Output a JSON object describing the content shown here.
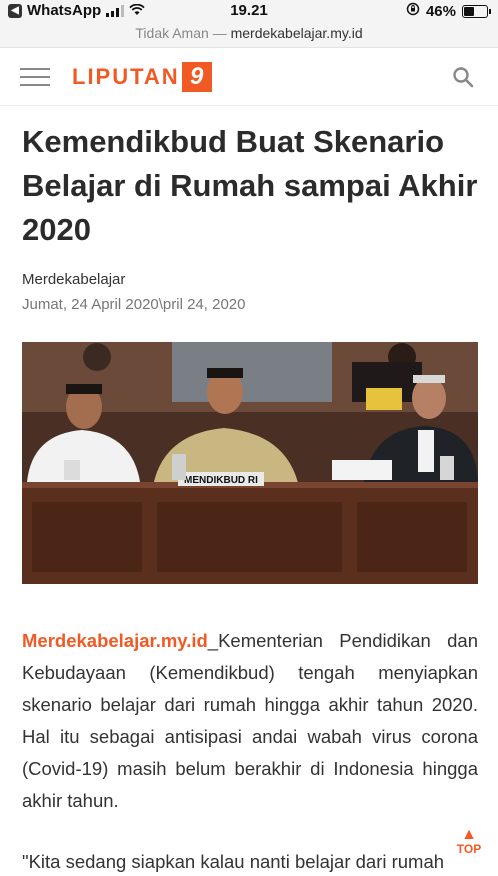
{
  "status_bar": {
    "app": "WhatsApp",
    "time": "19.21",
    "battery": "46%",
    "battery_level": 0.46
  },
  "url_bar": {
    "security": "Tidak Aman",
    "separator": "—",
    "domain": "merdekabelajar.my.id"
  },
  "site": {
    "logo_text": "LIPUTAN",
    "logo_number": "9"
  },
  "article": {
    "headline": "Kemendikbud Buat Skenario Belajar di Rumah sampai Akhir 2020",
    "author": "Merdekabelajar",
    "date": "Jumat, 24 April 2020\\pril 24, 2020",
    "photo_caption": "MENDIKBUD RI",
    "source_label": "Merdekabelajar.my.id",
    "lead": "_Kementerian Pendidikan dan Kebudayaan (Kemendikbud) tengah menyiapkan skenario belajar dari rumah hingga akhir tahun 2020. Hal itu sebagai antisipasi andai wabah virus corona (Covid-19) masih belum berakhir di Indonesia hingga akhir tahun.",
    "quote_start": "\"Kita sedang siapkan kalau nanti belajar dari rumah"
  },
  "back_to_top": {
    "label": "TOP"
  },
  "colors": {
    "accent": "#f15a24",
    "headline": "#2b2b2b"
  }
}
